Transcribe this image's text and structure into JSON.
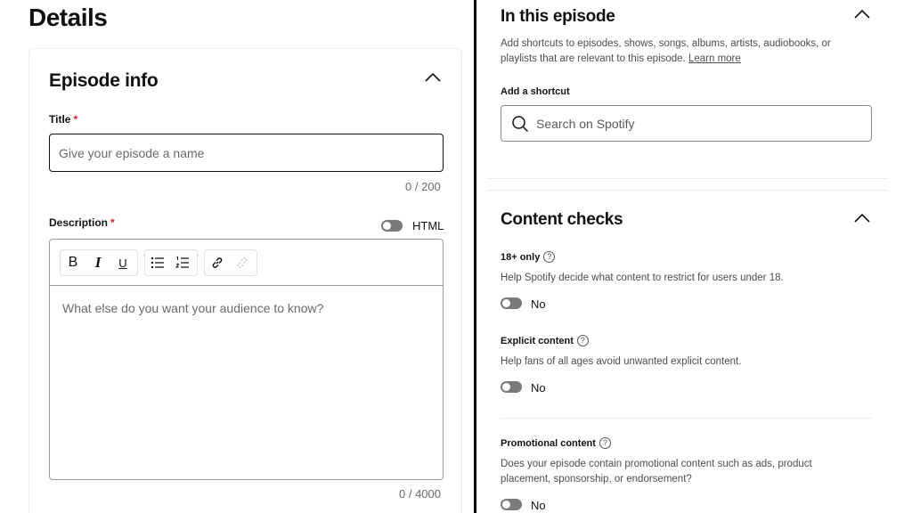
{
  "details": {
    "page_title": "Details",
    "episode_info": {
      "heading": "Episode info",
      "title_label": "Title",
      "required_mark": "*",
      "title_placeholder": "Give your episode a name",
      "title_counter": "0 / 200",
      "description_label": "Description",
      "html_toggle_label": "HTML",
      "toolbar": {
        "bold": "B",
        "italic": "I",
        "underline": "U"
      },
      "description_placeholder": "What else do you want your audience to know?",
      "description_counter": "0 / 4000"
    }
  },
  "in_this_episode": {
    "heading": "In this episode",
    "description": "Add shortcuts to episodes, shows, songs, albums, artists, audiobooks, or playlists that are relevant to this episode.",
    "learn_more": "Learn more",
    "shortcut_label": "Add a shortcut",
    "search_placeholder": "Search on Spotify"
  },
  "content_checks": {
    "heading": "Content checks",
    "items": [
      {
        "label": "18+ only",
        "help": "Help Spotify decide what content to restrict for users under 18.",
        "value": "No"
      },
      {
        "label": "Explicit content",
        "help": "Help fans of all ages avoid unwanted explicit content.",
        "value": "No"
      },
      {
        "label": "Promotional content",
        "help": "Does your episode contain promotional content such as ads, product placement, sponsorship, or endorsement?",
        "value": "No"
      }
    ]
  },
  "icons": {
    "chevron": "chevron-up-icon",
    "search": "search-icon",
    "help": "question-circle-icon",
    "bullet_list": "bullet-list-icon",
    "numbered_list": "numbered-list-icon",
    "link": "link-icon",
    "unlink": "unlink-icon"
  },
  "colors": {
    "required": "#e91429",
    "toggle_off": "#7a7a7a",
    "text": "#121212",
    "muted": "#6a6a6a"
  }
}
